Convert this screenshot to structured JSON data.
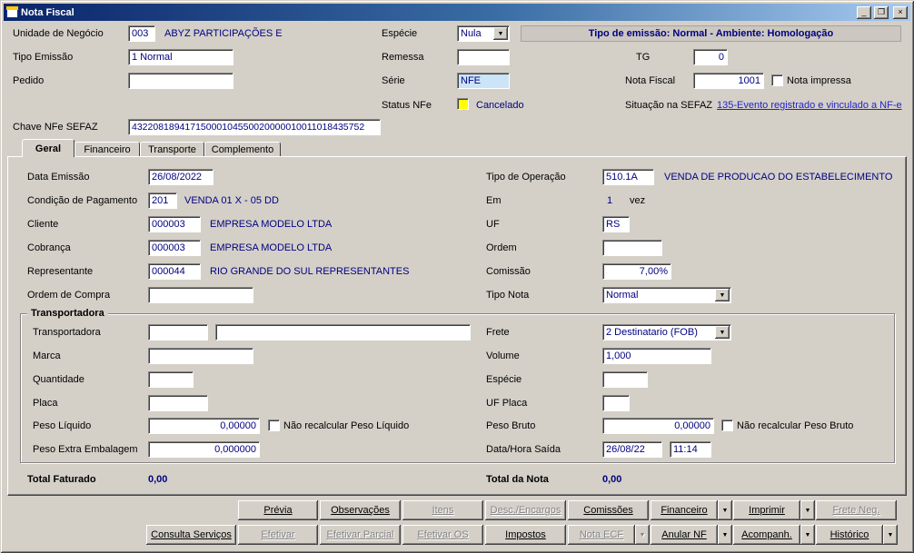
{
  "window": {
    "title": "Nota Fiscal"
  },
  "icons": {
    "minimize": "_",
    "maximize": "❐",
    "close": "×",
    "chevron_down": "▼"
  },
  "colors": {
    "accent_navy": "#000080",
    "status_yellow": "#ffff00",
    "link_blue": "#2222cc",
    "serie_field_bg": "#cbe4f7",
    "titlebar_start": "#0a246a",
    "titlebar_end": "#a6caf0"
  },
  "header": {
    "unidade_negocio_label": "Unidade de Negócio",
    "unidade_negocio_code": "003",
    "unidade_negocio_desc": "ABYZ PARTICIPAÇÕES E",
    "especie_label": "Espécie",
    "especie_value": "Nula",
    "emissao_banner": "Tipo de emissão: Normal - Ambiente: Homologação",
    "tipo_emissao_label": "Tipo Emissão",
    "tipo_emissao_value": "1 Normal",
    "remessa_label": "Remessa",
    "remessa_value": "",
    "tg_label": "TG",
    "tg_value": "0",
    "pedido_label": "Pedido",
    "pedido_value": "",
    "serie_label": "Série",
    "serie_value": "NFE",
    "nota_fiscal_label": "Nota Fiscal",
    "nota_fiscal_value": "1001",
    "nota_impressa_label": "Nota impressa",
    "nota_impressa_checked": false,
    "status_nfe_label": "Status NFe",
    "status_nfe_value": "Cancelado",
    "situacao_sefaz_label": "Situação na SEFAZ",
    "situacao_sefaz_link": "135-Evento registrado e vinculado a NF-e",
    "chave_label": "Chave NFe SEFAZ",
    "chave_value": "43220818941715000104550020000010011018435752"
  },
  "tabs": {
    "geral": "Geral",
    "financeiro": "Financeiro",
    "transporte": "Transporte",
    "complemento": "Complemento"
  },
  "geral": {
    "data_emissao_label": "Data Emissão",
    "data_emissao_value": "26/08/2022",
    "tipo_operacao_label": "Tipo de Operação",
    "tipo_operacao_code": "510.1A",
    "tipo_operacao_desc": "VENDA DE PRODUCAO DO ESTABELECIMENTO",
    "cond_pag_label": "Condição de Pagamento",
    "cond_pag_code": "201",
    "cond_pag_desc": "VENDA 01 X - 05 DD",
    "em_label": "Em",
    "em_value": "1",
    "em_suffix": "vez",
    "cliente_label": "Cliente",
    "cliente_code": "000003",
    "cliente_desc": "EMPRESA MODELO LTDA",
    "uf_label": "UF",
    "uf_value": "RS",
    "cobranca_label": "Cobrança",
    "cobranca_code": "000003",
    "cobranca_desc": "EMPRESA MODELO LTDA",
    "ordem_label": "Ordem",
    "ordem_value": "",
    "representante_label": "Representante",
    "representante_code": "000044",
    "representante_desc": "RIO GRANDE DO SUL REPRESENTANTES",
    "comissao_label": "Comissão",
    "comissao_value": "7,00%",
    "ordem_compra_label": "Ordem de Compra",
    "ordem_compra_value": "",
    "tipo_nota_label": "Tipo Nota",
    "tipo_nota_value": "Normal"
  },
  "transportadora": {
    "group_title": "Transportadora",
    "transportadora_label": "Transportadora",
    "transportadora_code": "",
    "transportadora_desc": "",
    "frete_label": "Frete",
    "frete_value": "2 Destinatario (FOB)",
    "marca_label": "Marca",
    "marca_value": "",
    "volume_label": "Volume",
    "volume_value": "1,000",
    "quantidade_label": "Quantidade",
    "quantidade_value": "",
    "especie_label": "Espécie",
    "especie_value": "",
    "placa_label": "Placa",
    "placa_value": "",
    "uf_placa_label": "UF Placa",
    "uf_placa_value": "",
    "peso_liquido_label": "Peso Líquido",
    "peso_liquido_value": "0,00000",
    "nao_recalc_liquido_label": "Não recalcular Peso Líquido",
    "nao_recalc_liquido_checked": false,
    "peso_bruto_label": "Peso Bruto",
    "peso_bruto_value": "0,00000",
    "nao_recalc_bruto_label": "Não recalcular Peso Bruto",
    "nao_recalc_bruto_checked": false,
    "peso_extra_label": "Peso Extra Embalagem",
    "peso_extra_value": "0,000000",
    "data_saida_label": "Data/Hora Saída",
    "data_saida_value": "26/08/22",
    "hora_saida_value": "11:14"
  },
  "totais": {
    "faturado_label": "Total Faturado",
    "faturado_value": "0,00",
    "nota_label": "Total da Nota",
    "nota_value": "0,00"
  },
  "buttons": {
    "row1": [
      {
        "label": "Prévia",
        "enabled": true,
        "split": false
      },
      {
        "label": "Observações",
        "enabled": true,
        "split": false
      },
      {
        "label": "Itens",
        "enabled": false,
        "split": false
      },
      {
        "label": "Desc./Encargos",
        "enabled": false,
        "split": false
      },
      {
        "label": "Comissões",
        "enabled": true,
        "split": false
      },
      {
        "label": "Financeiro",
        "enabled": true,
        "split": true
      },
      {
        "label": "Imprimir",
        "enabled": true,
        "split": true
      },
      {
        "label": "Frete Neg.",
        "enabled": false,
        "split": false
      }
    ],
    "row2": [
      {
        "label": "Consulta Serviços",
        "enabled": true,
        "split": false
      },
      {
        "label": "Efetivar",
        "enabled": false,
        "split": false
      },
      {
        "label": "Efetivar Parcial",
        "enabled": false,
        "split": false
      },
      {
        "label": "Efetivar OS",
        "enabled": false,
        "split": false
      },
      {
        "label": "Impostos",
        "enabled": true,
        "split": false
      },
      {
        "label": "Nota ECF",
        "enabled": false,
        "split": true
      },
      {
        "label": "Anular NF",
        "enabled": true,
        "split": true
      },
      {
        "label": "Acompanh.",
        "enabled": true,
        "split": true
      },
      {
        "label": "Histórico",
        "enabled": true,
        "split": true
      }
    ]
  }
}
